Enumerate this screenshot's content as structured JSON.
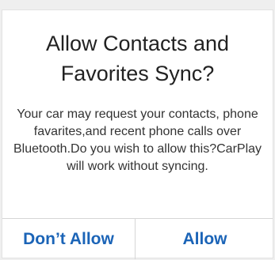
{
  "dialog": {
    "title": "Allow Contacts and Favorites Sync?",
    "message": "Your car may request your contacts, phone favarites,and recent phone calls over Bluetooth.Do you wish to allow this?CarPlay will work without syncing.",
    "buttons": {
      "dont_allow": "Don’t Allow",
      "allow": "Allow"
    }
  },
  "colors": {
    "accent": "#1b64b7",
    "background": "#efefef",
    "dialog": "#ffffff"
  }
}
